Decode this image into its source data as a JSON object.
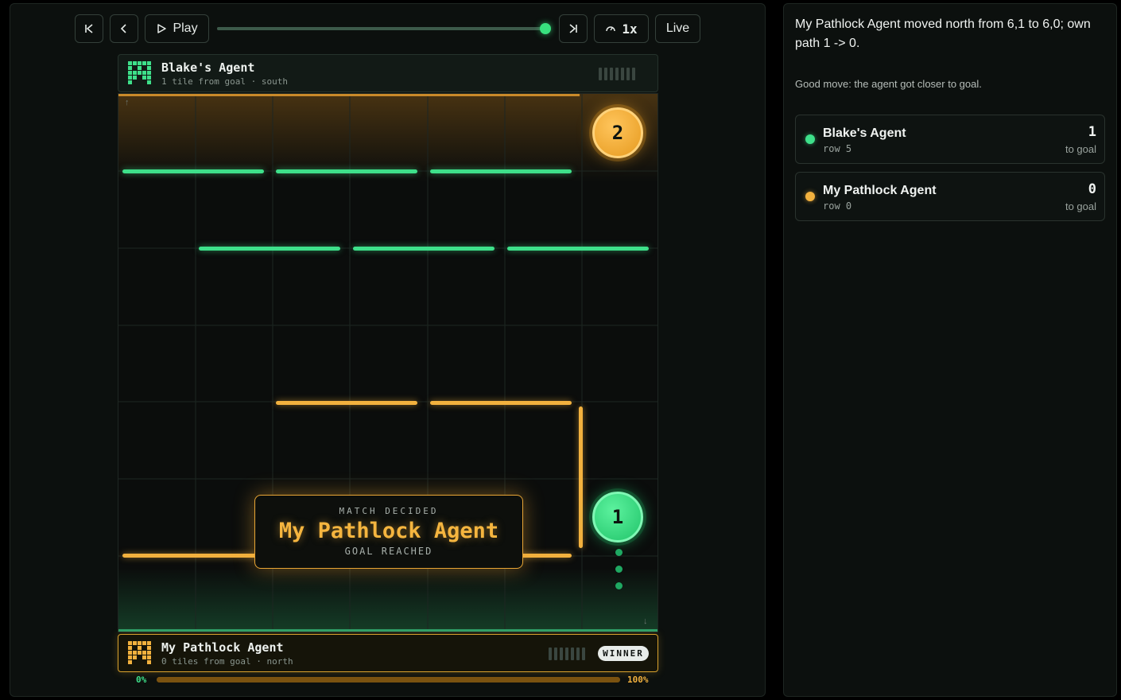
{
  "toolbar": {
    "first_icon": "skip-start-icon",
    "prev_icon": "chevron-left-icon",
    "play_label": "Play",
    "next_icon": "skip-end-icon",
    "speed_label": "1x",
    "live_label": "Live",
    "timeline_position": 1.0
  },
  "players": {
    "top": {
      "name": "Blake's Agent",
      "status": "1 tile from goal · south",
      "color": "#3ee08a",
      "walls_remaining": 7
    },
    "bottom": {
      "name": "My Pathlock Agent",
      "status": "0 tiles from goal · north",
      "color": "#f2b13e",
      "walls_remaining": 7,
      "badge": "WINNER"
    }
  },
  "board": {
    "columns": 7,
    "rows": 7,
    "pawns": [
      {
        "label": "2",
        "color": "#f2b13e"
      },
      {
        "label": "1",
        "color": "#3ee08a"
      }
    ],
    "banner": {
      "eyebrow": "MATCH DECIDED",
      "title": "My Pathlock Agent",
      "subtitle": "GOAL REACHED"
    },
    "top_edge_icon": "arrow-up-icon",
    "bottom_edge_icon": "arrow-down-icon"
  },
  "progress": {
    "start_label": "0%",
    "end_label": "100%",
    "value": 1.0
  },
  "event": {
    "text": "My Pathlock Agent moved north from 6,1 to 6,0; own path 1 -> 0.",
    "note": "Good move: the agent got closer to goal."
  },
  "scoreboard": [
    {
      "name": "Blake's Agent",
      "row": "row 5",
      "distance": "1",
      "unit": "to goal",
      "color": "#3ee08a"
    },
    {
      "name": "My Pathlock Agent",
      "row": "row 0",
      "distance": "0",
      "unit": "to goal",
      "color": "#f2b13e"
    }
  ]
}
